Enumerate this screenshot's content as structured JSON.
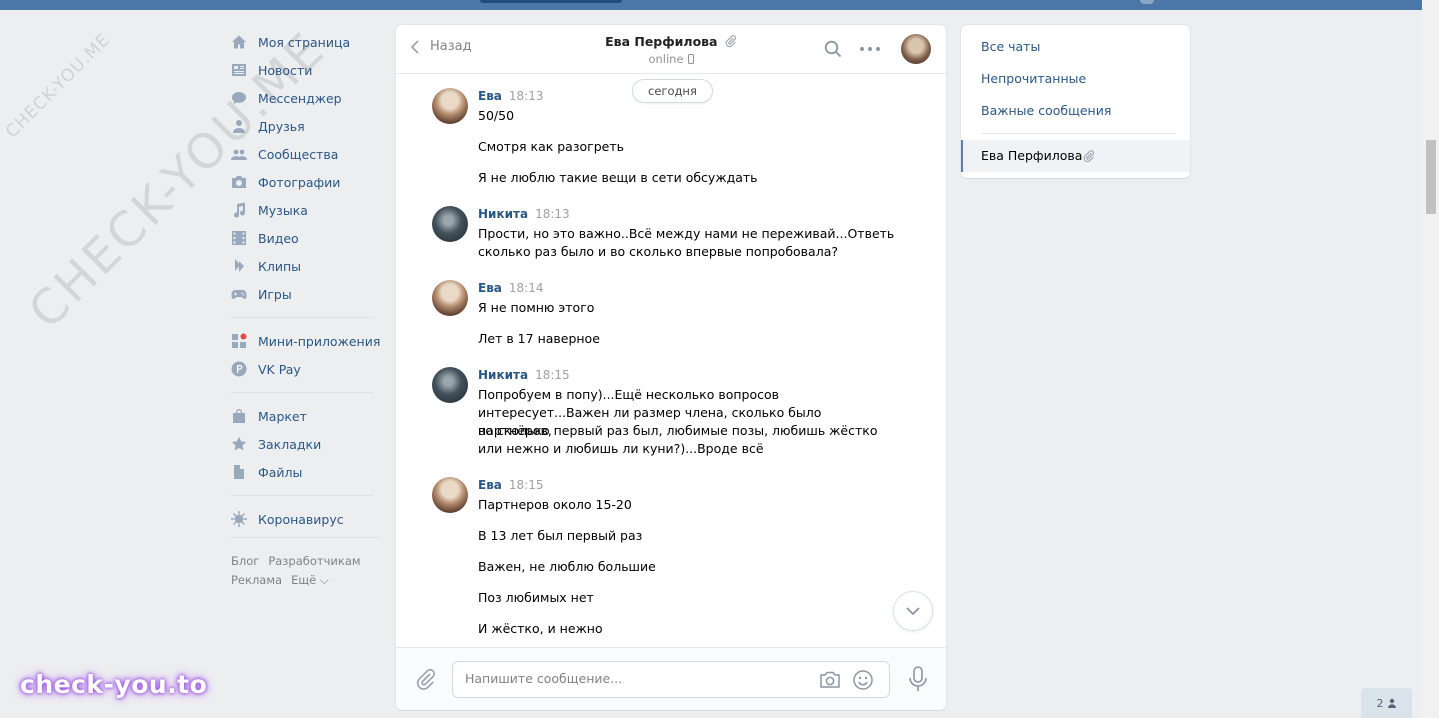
{
  "nav": {
    "items": [
      {
        "label": "Моя страница",
        "icon": "home-icon"
      },
      {
        "label": "Новости",
        "icon": "news-icon"
      },
      {
        "label": "Мессенджер",
        "icon": "messenger-icon"
      },
      {
        "label": "Друзья",
        "icon": "friends-icon"
      },
      {
        "label": "Сообщества",
        "icon": "communities-icon"
      },
      {
        "label": "Фотографии",
        "icon": "camera-icon"
      },
      {
        "label": "Музыка",
        "icon": "music-icon"
      },
      {
        "label": "Видео",
        "icon": "video-icon"
      },
      {
        "label": "Клипы",
        "icon": "clips-icon"
      },
      {
        "label": "Игры",
        "icon": "gamepad-icon"
      }
    ],
    "items2": [
      {
        "label": "Мини-приложения",
        "icon": "apps-icon"
      },
      {
        "label": "VK Pay",
        "icon": "vkpay-icon"
      }
    ],
    "items3": [
      {
        "label": "Маркет",
        "icon": "bag-icon"
      },
      {
        "label": "Закладки",
        "icon": "star-icon"
      },
      {
        "label": "Файлы",
        "icon": "file-icon"
      }
    ],
    "items4": [
      {
        "label": "Коронавирус",
        "icon": "virus-icon"
      }
    ],
    "footer": [
      "Блог",
      "Разработчикам",
      "Реклама",
      "Ещё ⌵"
    ]
  },
  "watermark": {
    "small": "CHECK-YOU.ME",
    "big": "CHECK-YOU.ME",
    "brand": "check-you.to"
  },
  "chat": {
    "back_label": "Назад",
    "title": "Ева Перфилова",
    "status": "online",
    "date_label": "сегодня",
    "messages": [
      {
        "author": "Ева",
        "time": "18:13",
        "lines": [
          "50/50",
          "Смотря как разогреть",
          "Я не люблю такие вещи в сети обсуждать"
        ]
      },
      {
        "author": "Никита",
        "time": "18:13",
        "lines": [
          "Прости, но это важно..Всё между нами не переживай...Ответь",
          "сколько раз было и во сколько впервые попробовала?"
        ]
      },
      {
        "author": "Ева",
        "time": "18:14",
        "lines": [
          "Я не помню этого",
          "Лет в 17 наверное"
        ]
      },
      {
        "author": "Никита",
        "time": "18:15",
        "lines": [
          "Попробуем в попу)...Ещё несколько вопросов",
          "интересует...Важен ли размер члена, сколько было партнёров,",
          "во сколько первый раз был, любимые позы, любишь жёстко",
          "или нежно и любишь ли куни?)...Вроде всё"
        ]
      },
      {
        "author": "Ева",
        "time": "18:15",
        "lines": [
          "Партнеров около 15-20",
          "В 13 лет был первый раз",
          "Важен, не люблю большие",
          "Поз любимых нет",
          "И жёстко, и нежно"
        ]
      }
    ],
    "input_placeholder": "Напишите сообщение..."
  },
  "folders": {
    "all": "Все чаты",
    "unread": "Непрочитанные",
    "important": "Важные сообщения",
    "active_chat": "Ева Перфилова"
  },
  "online_count": "2"
}
